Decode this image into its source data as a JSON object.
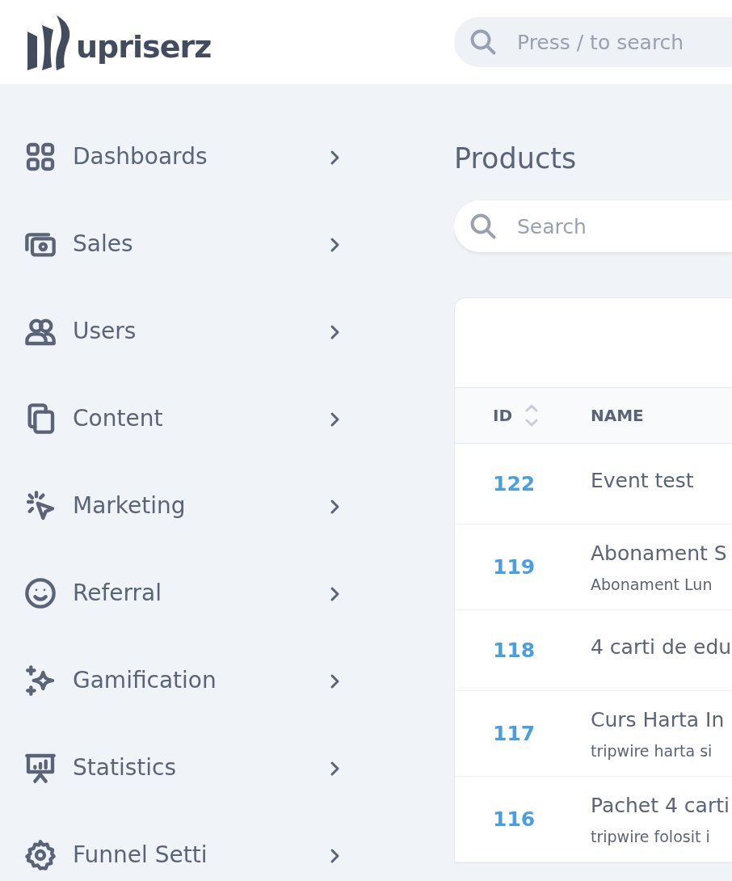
{
  "header": {
    "logo_text": "upriserz",
    "search": {
      "placeholder": "Press / to search"
    }
  },
  "sidebar": {
    "items": [
      {
        "label": "Dashboards",
        "expanded": false
      },
      {
        "label": "Sales",
        "expanded": false
      },
      {
        "label": "Users",
        "expanded": false
      },
      {
        "label": "Content",
        "expanded": false
      },
      {
        "label": "Marketing",
        "expanded": false
      },
      {
        "label": "Referral",
        "expanded": false
      },
      {
        "label": "Gamification",
        "expanded": false
      },
      {
        "label": "Statistics",
        "expanded": false
      },
      {
        "label": "Funnel Setti",
        "expanded": false
      }
    ]
  },
  "page": {
    "title": "Products",
    "search": {
      "placeholder": "Search"
    }
  },
  "table": {
    "columns": [
      {
        "label": "ID",
        "sortable": true
      },
      {
        "label": "NAME",
        "sortable": false
      }
    ],
    "rows": [
      {
        "id": "122",
        "name": "Event test"
      },
      {
        "id": "119",
        "name": "Abonament S",
        "subtitle": "Abonament Lun"
      },
      {
        "id": "118",
        "name": "4 carti de edu"
      },
      {
        "id": "117",
        "name": "Curs Harta In",
        "subtitle": "tripwire harta si"
      },
      {
        "id": "116",
        "name": "Pachet 4 carti",
        "subtitle": "tripwire folosit i"
      }
    ]
  }
}
